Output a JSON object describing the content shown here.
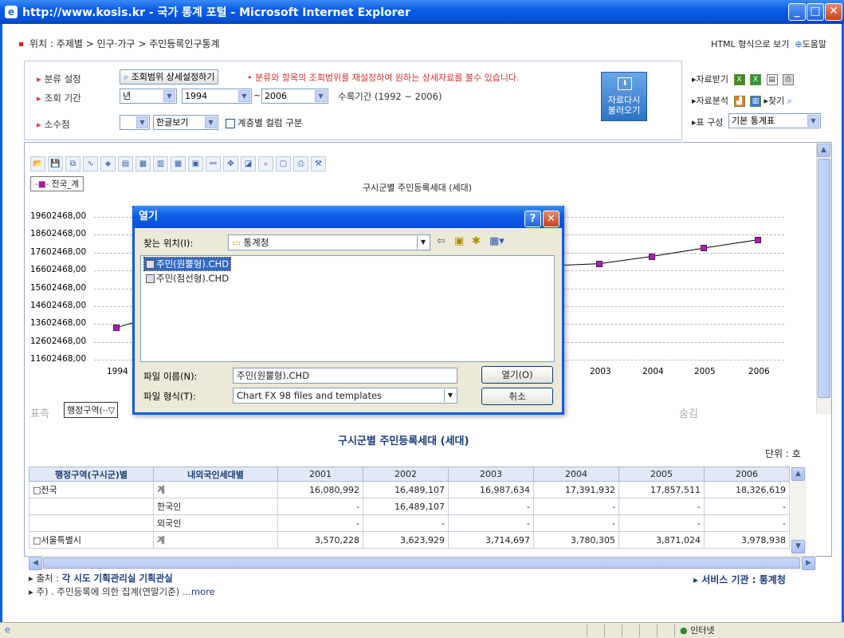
{
  "window": {
    "title": "http://www.kosis.kr - 국가 통계 포털 - Microsoft Internet Explorer"
  },
  "location": {
    "label": "위치 :",
    "crumb": "주제별 > 인구·가구 > 주민등록인구통계"
  },
  "toplinks": {
    "html_view": "HTML 형식으로 보기",
    "help": "도움말"
  },
  "filters": {
    "category_label": "분류 설정",
    "range_button": "조회범위 상세설정하기",
    "range_note": "• 분류와 항목의 조회범위를 재설정하여 원하는 상세자료를 볼수 있습니다.",
    "period_label": "조회 기간",
    "period_unit": "년",
    "period_from": "1994",
    "period_tilde": "~",
    "period_to": "2006",
    "period_note": "수록기간 (1992 ~ 2006)",
    "decimal_label": "소수점",
    "decimal_value": "",
    "view_value": "한글보기",
    "layer_label": "계층별 컬럼 구분"
  },
  "reload_button": {
    "line1": "자료다시",
    "line2": "불러오기"
  },
  "right_panel": {
    "download": "자료받기",
    "analysis": "자료분석",
    "find": "찾기",
    "table_label": "표 구성",
    "table_value": "기본 통계표"
  },
  "chart_data": {
    "type": "line",
    "title": "구시군별 주민등록세대 (세대)",
    "legend": "전국_계",
    "x": [
      "1994",
      "2003",
      "2004",
      "2005",
      "2006"
    ],
    "yticks": [
      "19602468,00",
      "18602468,00",
      "17602468,00",
      "16602468,00",
      "15602468,00",
      "14602468,00",
      "13602468,00",
      "12602468,00",
      "11602468,00"
    ],
    "ylim": [
      11602468,
      19602468
    ],
    "visible_points": [
      {
        "x": "1994",
        "y": 13400000
      },
      {
        "x": "2003",
        "y": 16987634
      },
      {
        "x": "2004",
        "y": 17391932
      },
      {
        "x": "2005",
        "y": 17857511
      },
      {
        "x": "2006",
        "y": 18326619
      }
    ]
  },
  "pivot": {
    "left": "표측",
    "selector": "행정구역(··▽",
    "right": "숨김"
  },
  "dialog": {
    "title": "열기",
    "lookin_label": "찾는 위치(I):",
    "lookin_value": "통계청",
    "files": [
      "주민(원뿔형).CHD",
      "주민(점선형).CHD"
    ],
    "filename_label": "파일 이름(N):",
    "filename_value": "주민(원뿔형).CHD",
    "filetype_label": "파일 형식(T):",
    "filetype_value": "Chart FX 98 files and templates",
    "open_button": "열기(O)",
    "cancel_button": "취소"
  },
  "table": {
    "title": "구시군별 주민등록세대 (세대)",
    "unit": "단위 : 호",
    "headers": [
      "행정구역(구시군)별",
      "내외국인세대별",
      "2001",
      "2002",
      "2003",
      "2004",
      "2005",
      "2006"
    ],
    "rows": [
      [
        "□전국",
        "계",
        "16,080,992",
        "16,489,107",
        "16,987,634",
        "17,391,932",
        "17,857,511",
        "18,326,619"
      ],
      [
        "",
        "한국인",
        "-",
        "16,489,107",
        "-",
        "-",
        "-",
        "-"
      ],
      [
        "",
        "외국인",
        "-",
        "-",
        "-",
        "-",
        "-",
        "-"
      ],
      [
        "□서울특별시",
        "계",
        "3,570,228",
        "3,623,929",
        "3,714,697",
        "3,780,305",
        "3,871,024",
        "3,978,938"
      ]
    ]
  },
  "footer": {
    "source_label": "출처 :",
    "source_value": "각 시도 기획관리실 기획관실",
    "note": "주) . 주민등록에 의한 집계(연말기준)",
    "more": "...more",
    "service": "서비스 기관 : 통계청"
  },
  "statusbar": {
    "zone": "인터넷"
  }
}
